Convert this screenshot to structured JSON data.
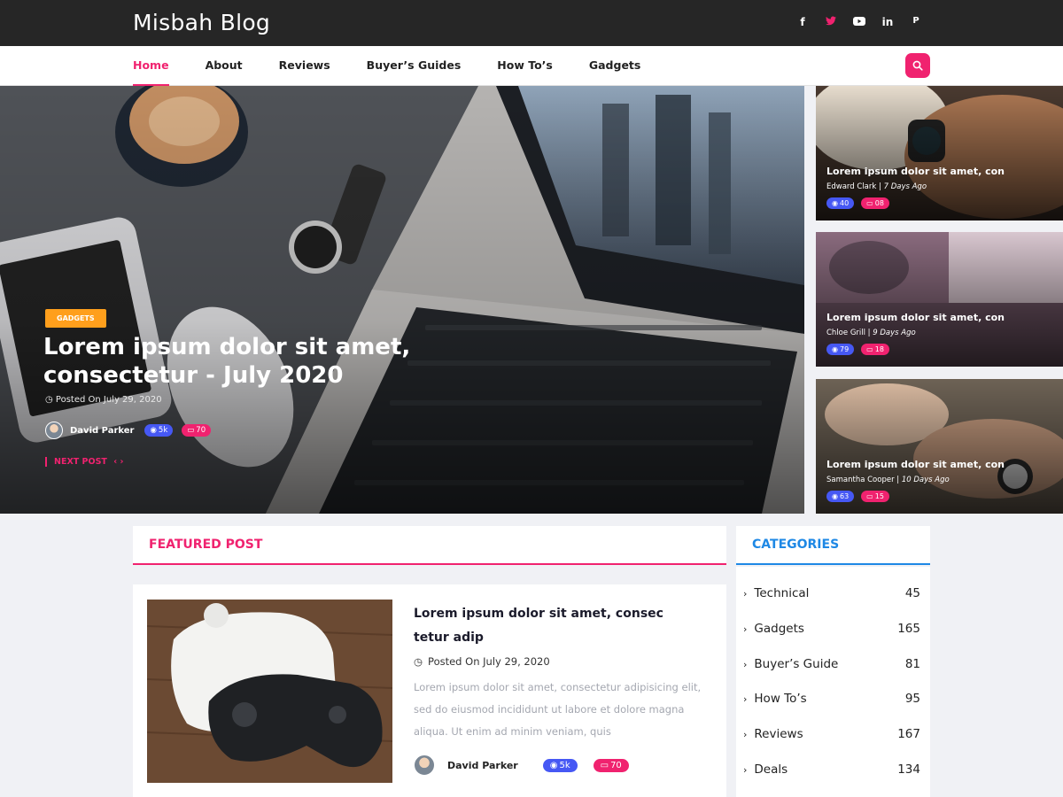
{
  "site": {
    "title": "Misbah Blog"
  },
  "social": [
    "facebook-icon",
    "twitter-icon",
    "youtube-icon",
    "linkedin-icon",
    "pinterest-icon"
  ],
  "social_labels": {
    "facebook": "f",
    "twitter": "t",
    "youtube": "▶",
    "linkedin": "in",
    "pinterest": "P"
  },
  "nav": {
    "items": [
      "Home",
      "About",
      "Reviews",
      "Buyer’s Guides",
      "How To’s",
      "Gadgets"
    ],
    "active": "Home"
  },
  "colors": {
    "accent": "#f0226f",
    "blue": "#4658f4",
    "orange": "#ff9f1c",
    "categories_heading": "#1e88e5"
  },
  "hero": {
    "badge": "GADGETS",
    "title": "Lorem ipsum dolor sit amet, consectetur - July 2020",
    "date": "Posted On July 29, 2020",
    "author": "David Parker",
    "views": "5k",
    "comments": "70",
    "next": "NEXT POST"
  },
  "side_posts": [
    {
      "title": "Lorem ipsum dolor sit amet, con",
      "author": "Edward Clark",
      "ago": "7 Days Ago",
      "views": "40",
      "comments": "08"
    },
    {
      "title": "Lorem ipsum dolor sit amet, con",
      "author": "Chloe Grill",
      "ago": "9 Days Ago",
      "views": "79",
      "comments": "18"
    },
    {
      "title": "Lorem ipsum dolor sit amet, con",
      "author": "Samantha Cooper",
      "ago": "10 Days Ago",
      "views": "63",
      "comments": "15"
    }
  ],
  "featured": {
    "heading": "FEATURED POST",
    "title": "Lorem ipsum dolor sit amet, consec tetur adip",
    "date": "Posted On July 29, 2020",
    "excerpt": "Lorem ipsum dolor sit amet, consectetur adipisicing elit, sed do eiusmod  incididunt ut labore et dolore magna aliqua. Ut enim ad minim veniam, quis",
    "author": "David Parker",
    "views": "5k",
    "comments": "70"
  },
  "categories": {
    "heading": "CATEGORIES",
    "items": [
      {
        "name": "Technical",
        "count": "45"
      },
      {
        "name": "Gadgets",
        "count": "165"
      },
      {
        "name": "Buyer’s Guide",
        "count": "81"
      },
      {
        "name": "How To’s",
        "count": "95"
      },
      {
        "name": "Reviews",
        "count": "167"
      },
      {
        "name": "Deals",
        "count": "134"
      }
    ]
  }
}
